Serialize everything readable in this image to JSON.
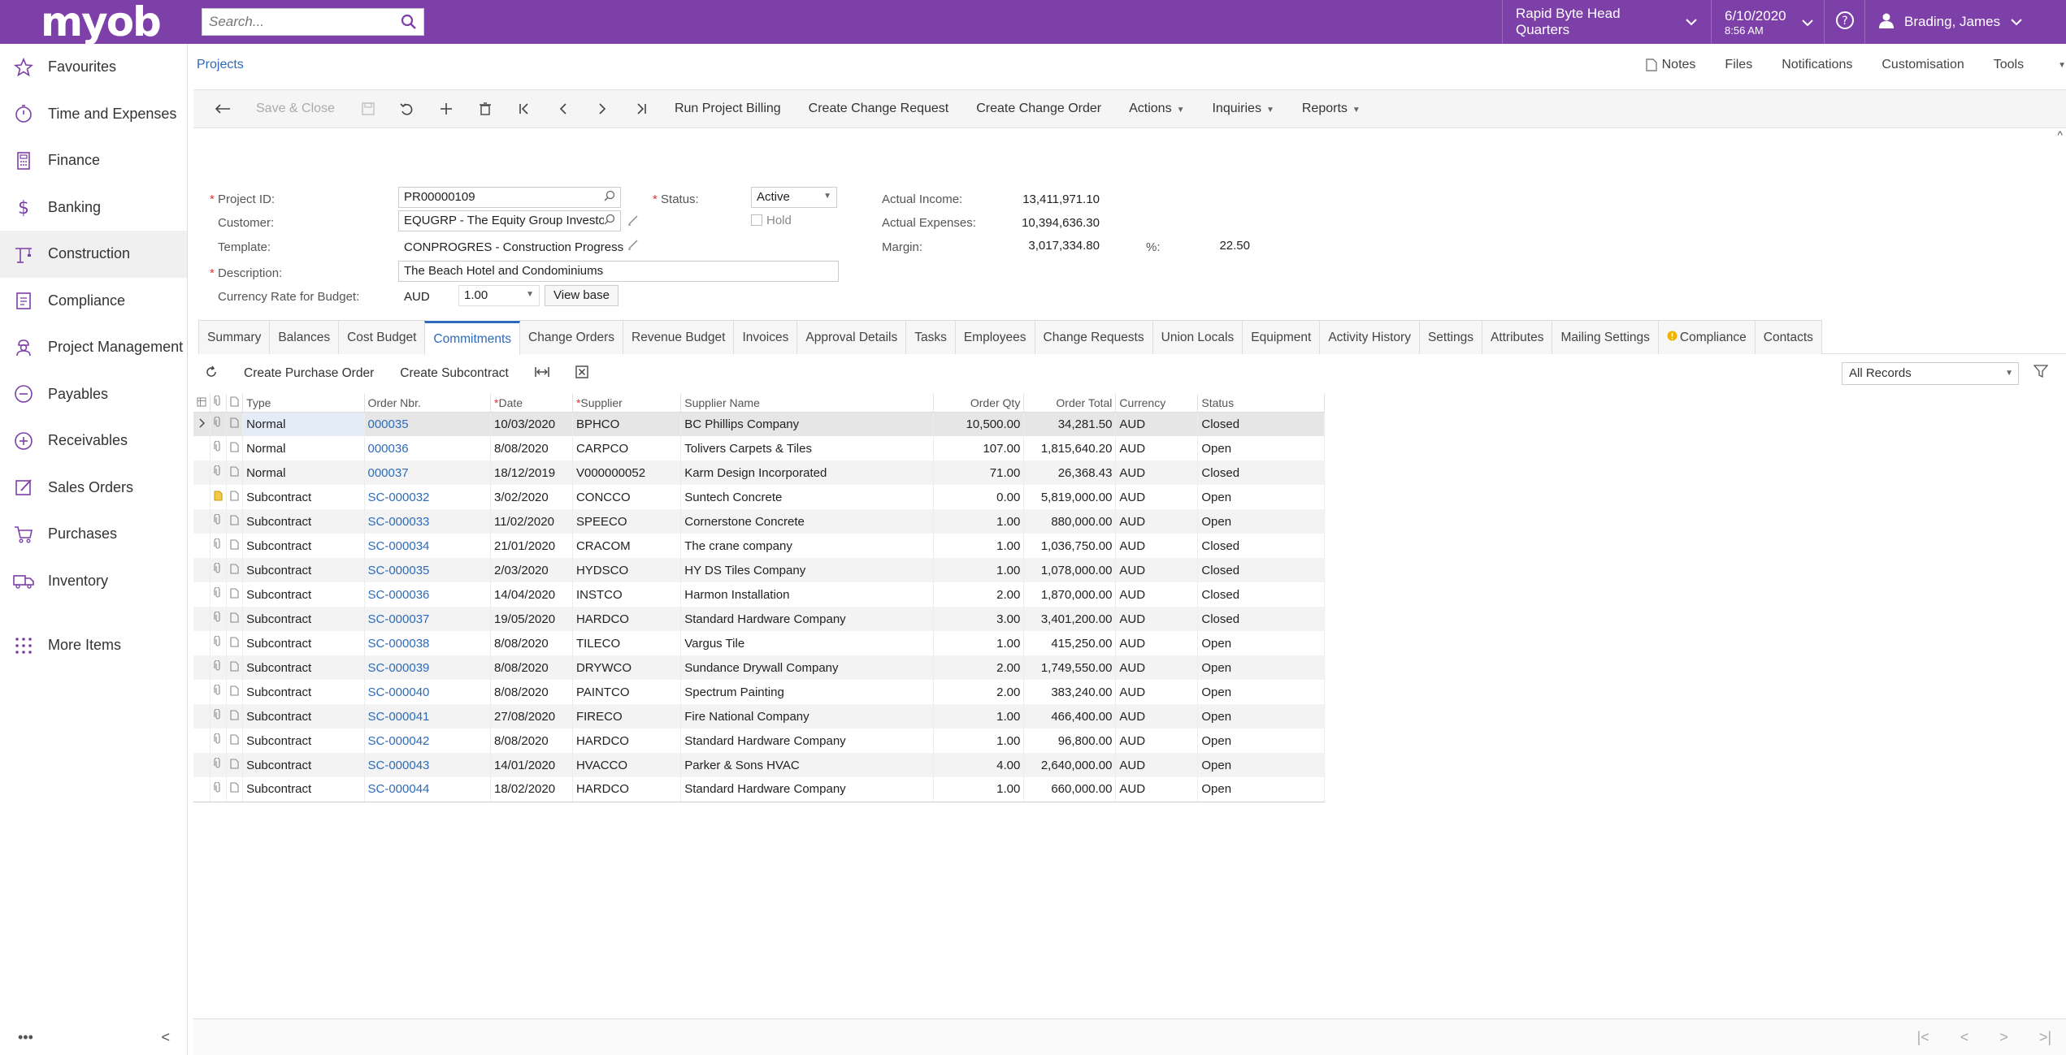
{
  "app": {
    "logo": "myob"
  },
  "search": {
    "placeholder": "Search..."
  },
  "topbar": {
    "branch": "Rapid Byte Head Quarters",
    "date": "6/10/2020",
    "time": "8:56 AM",
    "user": "Brading, James"
  },
  "sidebar": {
    "items": [
      {
        "label": "Favourites",
        "icon": "star-icon"
      },
      {
        "label": "Time and Expenses",
        "icon": "stopwatch-icon"
      },
      {
        "label": "Finance",
        "icon": "calculator-icon"
      },
      {
        "label": "Banking",
        "icon": "dollar-icon"
      },
      {
        "label": "Construction",
        "icon": "crane-icon"
      },
      {
        "label": "Compliance",
        "icon": "clipboard-icon"
      },
      {
        "label": "Project Management",
        "icon": "worker-icon"
      },
      {
        "label": "Payables",
        "icon": "minus-circle-icon"
      },
      {
        "label": "Receivables",
        "icon": "plus-circle-icon"
      },
      {
        "label": "Sales Orders",
        "icon": "pencil-square-icon"
      },
      {
        "label": "Purchases",
        "icon": "cart-icon"
      },
      {
        "label": "Inventory",
        "icon": "truck-icon"
      }
    ],
    "more": "More Items",
    "bottom_dots": "•••",
    "collapse": "<"
  },
  "breadcrumb": "Projects",
  "utils": {
    "notes": "Notes",
    "files": "Files",
    "notifications": "Notifications",
    "customisation": "Customisation",
    "tools": "Tools"
  },
  "toolbar": {
    "save_close": "Save & Close",
    "run_billing": "Run Project Billing",
    "create_cr": "Create Change Request",
    "create_co": "Create Change Order",
    "actions": "Actions",
    "inquiries": "Inquiries",
    "reports": "Reports"
  },
  "form": {
    "project_id_label": "Project ID:",
    "project_id": "PR00000109",
    "customer_label": "Customer:",
    "customer": "EQUGRP - The Equity Group Investor",
    "template_label": "Template:",
    "template": "CONPROGRES - Construction Progress",
    "description_label": "Description:",
    "description": "The Beach Hotel and Condominiums",
    "currency_rate_label": "Currency Rate for Budget:",
    "currency": "AUD",
    "rate": "1.00",
    "view_base": "View base",
    "status_label": "Status:",
    "status": "Active",
    "hold_label": "Hold",
    "actual_income_label": "Actual Income:",
    "actual_income": "13,411,971.10",
    "actual_expenses_label": "Actual Expenses:",
    "actual_expenses": "10,394,636.30",
    "margin_label": "Margin:",
    "margin": "3,017,334.80",
    "pct_label": "%:",
    "pct": "22.50"
  },
  "tabs": [
    "Summary",
    "Balances",
    "Cost Budget",
    "Commitments",
    "Change Orders",
    "Revenue Budget",
    "Invoices",
    "Approval Details",
    "Tasks",
    "Employees",
    "Change Requests",
    "Union Locals",
    "Equipment",
    "Activity History",
    "Settings",
    "Attributes",
    "Mailing Settings",
    "Compliance",
    "Contacts"
  ],
  "active_tab": "Commitments",
  "gridbar": {
    "create_po": "Create Purchase Order",
    "create_sub": "Create Subcontract",
    "filter": "All Records"
  },
  "grid": {
    "headers": {
      "type": "Type",
      "order_nbr": "Order Nbr.",
      "date": "Date",
      "supplier": "Supplier",
      "supplier_name": "Supplier Name",
      "order_qty": "Order Qty",
      "order_total": "Order Total",
      "currency": "Currency",
      "status": "Status"
    },
    "rows": [
      {
        "type": "Normal",
        "order_nbr": "000035",
        "date": "10/03/2020",
        "supplier": "BPHCO",
        "supplier_name": "BC Phillips Company",
        "order_qty": "10,500.00",
        "order_total": "34,281.50",
        "currency": "AUD",
        "status": "Closed"
      },
      {
        "type": "Normal",
        "order_nbr": "000036",
        "date": "8/08/2020",
        "supplier": "CARPCO",
        "supplier_name": "Tolivers Carpets & Tiles",
        "order_qty": "107.00",
        "order_total": "1,815,640.20",
        "currency": "AUD",
        "status": "Open"
      },
      {
        "type": "Normal",
        "order_nbr": "000037",
        "date": "18/12/2019",
        "supplier": "V000000052",
        "supplier_name": "Karm Design Incorporated",
        "order_qty": "71.00",
        "order_total": "26,368.43",
        "currency": "AUD",
        "status": "Closed"
      },
      {
        "type": "Subcontract",
        "order_nbr": "SC-000032",
        "date": "3/02/2020",
        "supplier": "CONCCO",
        "supplier_name": "Suntech Concrete",
        "order_qty": "0.00",
        "order_total": "5,819,000.00",
        "currency": "AUD",
        "status": "Open"
      },
      {
        "type": "Subcontract",
        "order_nbr": "SC-000033",
        "date": "11/02/2020",
        "supplier": "SPEECO",
        "supplier_name": "Cornerstone Concrete",
        "order_qty": "1.00",
        "order_total": "880,000.00",
        "currency": "AUD",
        "status": "Open"
      },
      {
        "type": "Subcontract",
        "order_nbr": "SC-000034",
        "date": "21/01/2020",
        "supplier": "CRACOM",
        "supplier_name": "The crane company",
        "order_qty": "1.00",
        "order_total": "1,036,750.00",
        "currency": "AUD",
        "status": "Closed"
      },
      {
        "type": "Subcontract",
        "order_nbr": "SC-000035",
        "date": "2/03/2020",
        "supplier": "HYDSCO",
        "supplier_name": "HY DS Tiles Company",
        "order_qty": "1.00",
        "order_total": "1,078,000.00",
        "currency": "AUD",
        "status": "Closed"
      },
      {
        "type": "Subcontract",
        "order_nbr": "SC-000036",
        "date": "14/04/2020",
        "supplier": "INSTCO",
        "supplier_name": "Harmon Installation",
        "order_qty": "2.00",
        "order_total": "1,870,000.00",
        "currency": "AUD",
        "status": "Closed"
      },
      {
        "type": "Subcontract",
        "order_nbr": "SC-000037",
        "date": "19/05/2020",
        "supplier": "HARDCO",
        "supplier_name": "Standard Hardware Company",
        "order_qty": "3.00",
        "order_total": "3,401,200.00",
        "currency": "AUD",
        "status": "Closed"
      },
      {
        "type": "Subcontract",
        "order_nbr": "SC-000038",
        "date": "8/08/2020",
        "supplier": "TILECO",
        "supplier_name": "Vargus Tile",
        "order_qty": "1.00",
        "order_total": "415,250.00",
        "currency": "AUD",
        "status": "Open"
      },
      {
        "type": "Subcontract",
        "order_nbr": "SC-000039",
        "date": "8/08/2020",
        "supplier": "DRYWCO",
        "supplier_name": "Sundance Drywall Company",
        "order_qty": "2.00",
        "order_total": "1,749,550.00",
        "currency": "AUD",
        "status": "Open"
      },
      {
        "type": "Subcontract",
        "order_nbr": "SC-000040",
        "date": "8/08/2020",
        "supplier": "PAINTCO",
        "supplier_name": "Spectrum Painting",
        "order_qty": "2.00",
        "order_total": "383,240.00",
        "currency": "AUD",
        "status": "Open"
      },
      {
        "type": "Subcontract",
        "order_nbr": "SC-000041",
        "date": "27/08/2020",
        "supplier": "FIRECO",
        "supplier_name": "Fire National Company",
        "order_qty": "1.00",
        "order_total": "466,400.00",
        "currency": "AUD",
        "status": "Open"
      },
      {
        "type": "Subcontract",
        "order_nbr": "SC-000042",
        "date": "8/08/2020",
        "supplier": "HARDCO",
        "supplier_name": "Standard Hardware Company",
        "order_qty": "1.00",
        "order_total": "96,800.00",
        "currency": "AUD",
        "status": "Open"
      },
      {
        "type": "Subcontract",
        "order_nbr": "SC-000043",
        "date": "14/01/2020",
        "supplier": "HVACCO",
        "supplier_name": "Parker & Sons HVAC",
        "order_qty": "4.00",
        "order_total": "2,640,000.00",
        "currency": "AUD",
        "status": "Open"
      },
      {
        "type": "Subcontract",
        "order_nbr": "SC-000044",
        "date": "18/02/2020",
        "supplier": "HARDCO",
        "supplier_name": "Standard Hardware Company",
        "order_qty": "1.00",
        "order_total": "660,000.00",
        "currency": "AUD",
        "status": "Open"
      }
    ]
  },
  "colors": {
    "brand": "#7d3fa8",
    "link": "#2e6ab8",
    "required": "#d33333"
  }
}
